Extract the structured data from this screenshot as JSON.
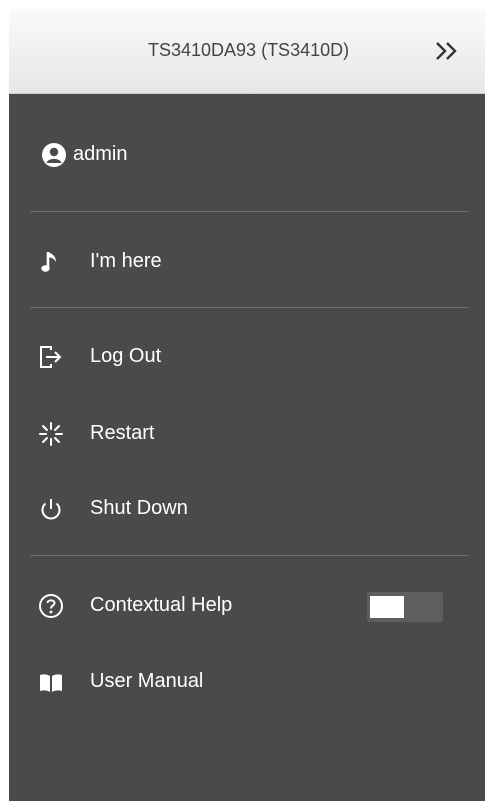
{
  "header": {
    "title": "TS3410DA93 (TS3410D)",
    "collapse_icon": "double-chevron-right-icon"
  },
  "user": {
    "name": "admin",
    "icon": "user-circle-icon"
  },
  "menu": {
    "im_here": {
      "label": "I'm here",
      "icon": "music-note-icon"
    },
    "logout": {
      "label": "Log Out",
      "icon": "logout-icon"
    },
    "restart": {
      "label": "Restart",
      "icon": "restart-icon"
    },
    "shutdown": {
      "label": "Shut Down",
      "icon": "power-icon"
    },
    "contextual_help": {
      "label": "Contextual Help",
      "icon": "question-circle-icon",
      "enabled": false
    },
    "user_manual": {
      "label": "User Manual",
      "icon": "book-icon"
    }
  },
  "colors": {
    "panel_bg": "#4a4a48",
    "header_bg": "#f2f2f0",
    "text": "#ffffff",
    "separator": "#6e6e6c"
  }
}
